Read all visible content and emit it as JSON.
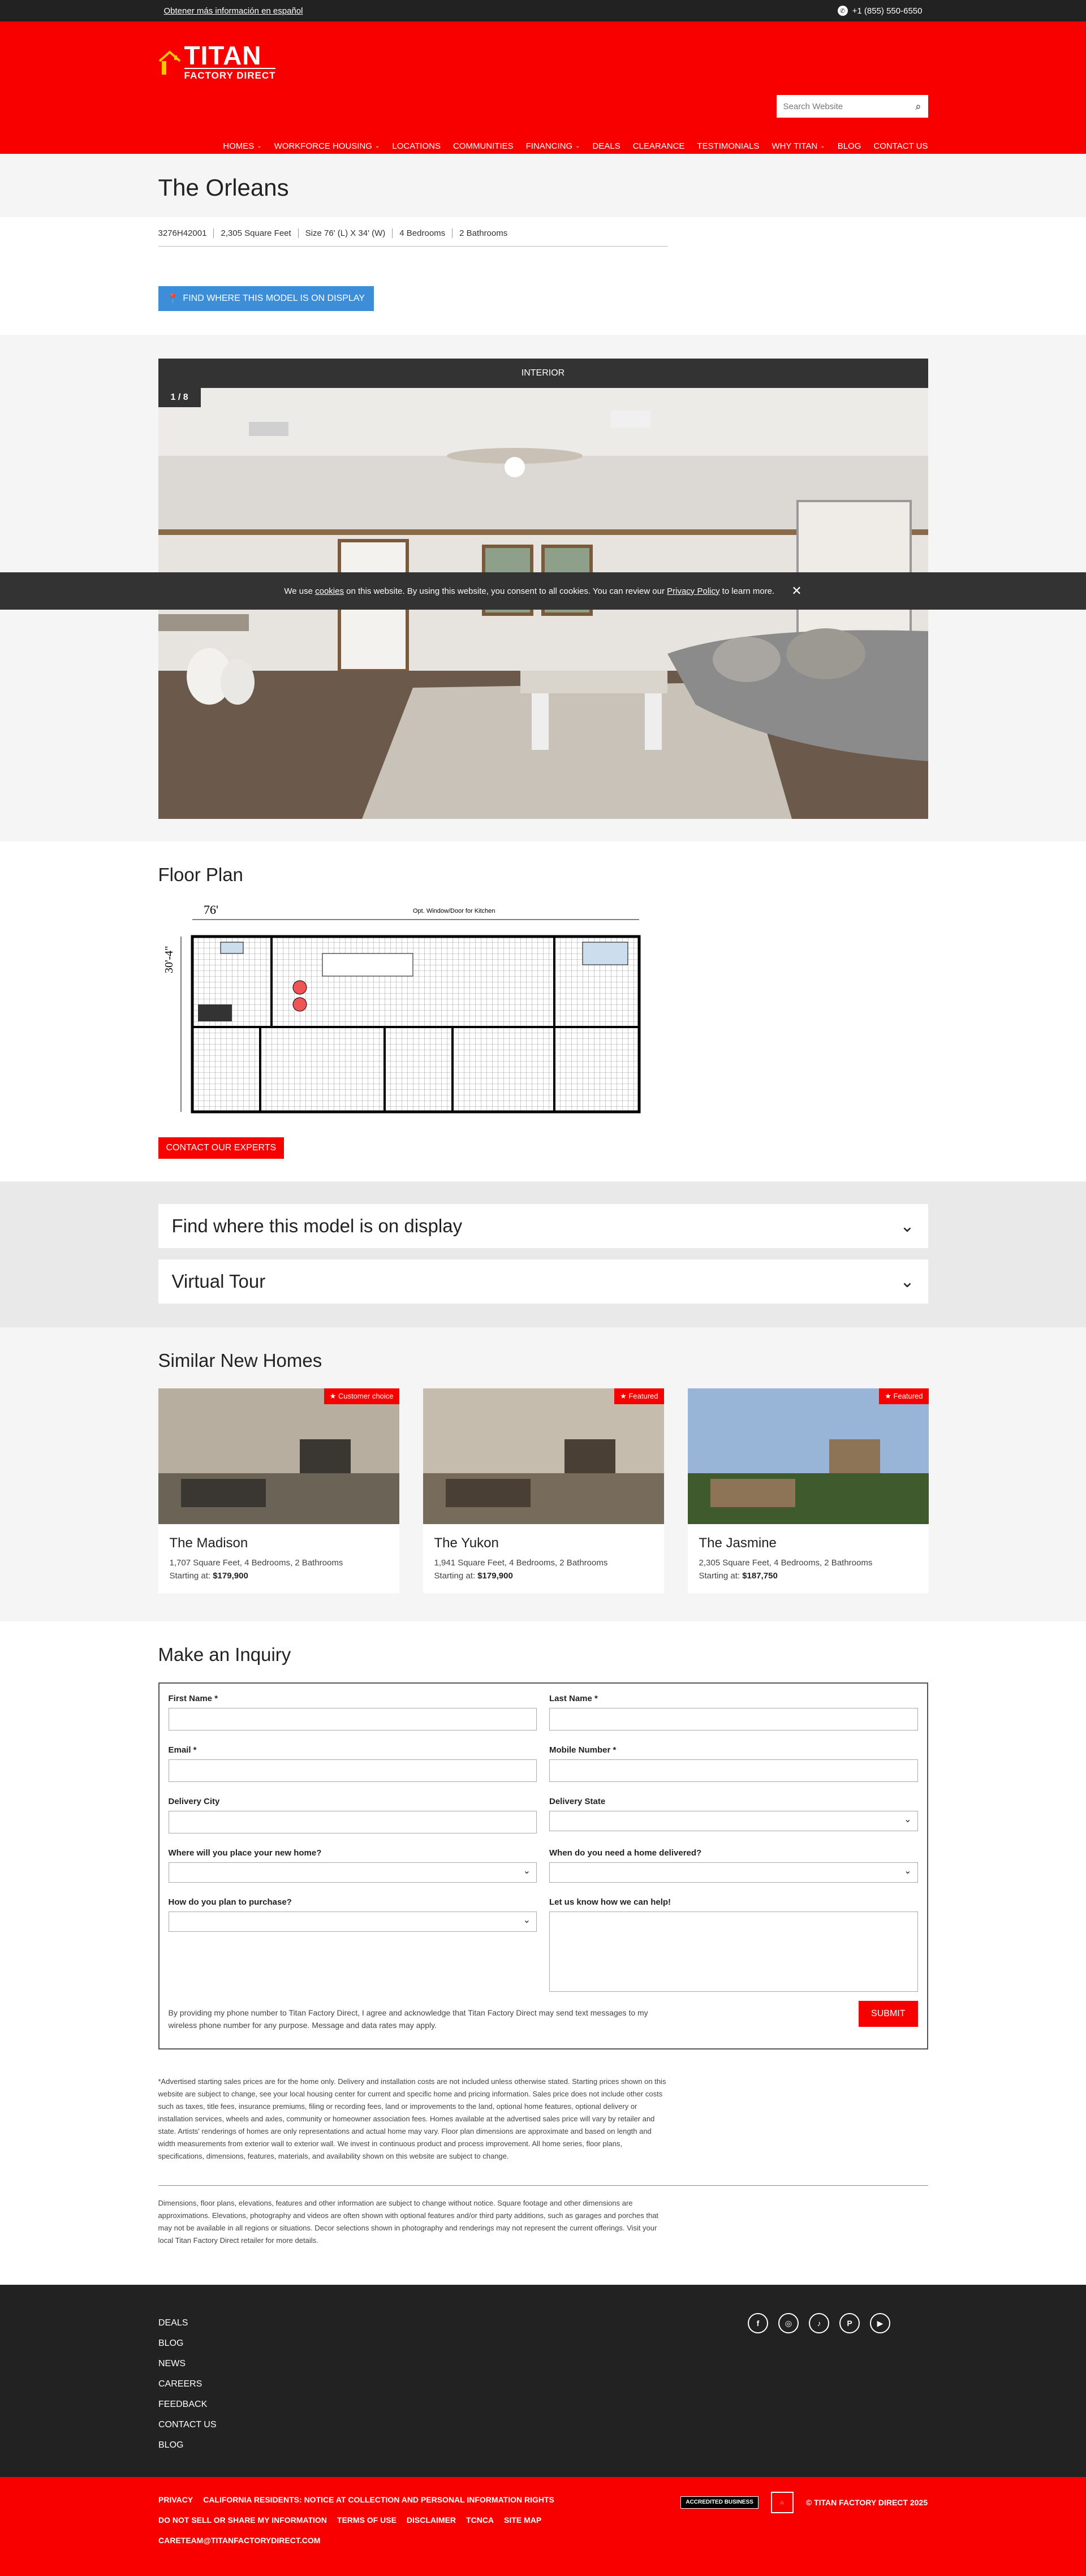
{
  "topbar": {
    "lang": "Obtener más información en español",
    "phone": "+1 (855) 550-6550"
  },
  "brand": {
    "name": "TITAN",
    "tagline": "FACTORY DIRECT"
  },
  "search": {
    "placeholder": "Search Website"
  },
  "nav": [
    {
      "label": "Homes",
      "dropdown": true
    },
    {
      "label": "Workforce Housing",
      "dropdown": true
    },
    {
      "label": "Locations",
      "dropdown": false
    },
    {
      "label": "Communities",
      "dropdown": false
    },
    {
      "label": "Financing",
      "dropdown": true
    },
    {
      "label": "Deals",
      "dropdown": false
    },
    {
      "label": "Clearance",
      "dropdown": false
    },
    {
      "label": "Testimonials",
      "dropdown": false
    },
    {
      "label": "Why Titan",
      "dropdown": true
    },
    {
      "label": "Blog",
      "dropdown": false
    },
    {
      "label": "Contact Us",
      "dropdown": false
    }
  ],
  "model": {
    "title": "The Orleans",
    "specs": [
      "3276H42001",
      "2,305 Square Feet",
      "Size 76' (L) X 34' (W)",
      "4 Bedrooms",
      "2 Bathrooms"
    ],
    "find_button": "Find where this model is on display"
  },
  "gallery": {
    "header": "Interior",
    "counter": "1 / 8"
  },
  "cookie": {
    "pre": "We use ",
    "link1": "cookies",
    "mid": " on this website. By using this website, you consent to all cookies. You can review our ",
    "link2": "Privacy Policy",
    "post": " to learn more."
  },
  "floorplan": {
    "title": "Floor Plan",
    "width_label": "76'",
    "depth_label": "30'-4\"",
    "note": "Opt. Window/Door for Kitchen",
    "button": "Contact Our Experts"
  },
  "accordions": [
    "Find where this model is on display",
    "Virtual Tour"
  ],
  "similar": {
    "title": "Similar New Homes",
    "cards": [
      {
        "badge": "Customer choice",
        "name": "The Madison",
        "details": "1,707 Square Feet, 4 Bedrooms, 2 Bathrooms",
        "price_label": "Starting at:",
        "price": "$179,900"
      },
      {
        "badge": "Featured",
        "name": "The Yukon",
        "details": "1,941 Square Feet, 4 Bedrooms, 2 Bathrooms",
        "price_label": "Starting at:",
        "price": "$179,900"
      },
      {
        "badge": "Featured",
        "name": "The Jasmine",
        "details": "2,305 Square Feet, 4 Bedrooms, 2 Bathrooms",
        "price_label": "Starting at:",
        "price": "$187,750"
      }
    ]
  },
  "inquiry": {
    "title": "Make an Inquiry",
    "first_name": "First Name *",
    "last_name": "Last Name *",
    "email": "Email *",
    "mobile": "Mobile Number *",
    "city": "Delivery City",
    "state": "Delivery State",
    "place": "Where will you place your new home?",
    "when": "When do you need a home delivered?",
    "purchase": "How do you plan to purchase?",
    "help": "Let us know how we can help!",
    "consent": "By providing my phone number to Titan Factory Direct, I agree and acknowledge that Titan Factory Direct may send text messages to my wireless phone number for any purpose. Message and data rates may apply.",
    "submit": "Submit"
  },
  "disclaimer": "*Advertised starting sales prices are for the home only. Delivery and installation costs are not included unless otherwise stated. Starting prices shown on this website are subject to change, see your local housing center for current and specific home and pricing information. Sales price does not include other costs such as taxes, title fees, insurance premiums, filing or recording fees, land or improvements to the land, optional home features, optional delivery or installation services, wheels and axles, community or homeowner association fees. Homes available at the advertised sales price will vary by retailer and state. Artists' renderings of homes are only representations and actual home may vary. Floor plan dimensions are approximate and based on length and width measurements from exterior wall to exterior wall. We invest in continuous product and process improvement. All home series, floor plans, specifications, dimensions, features, materials, and availability shown on this website are subject to change.",
  "disclaimer2": "Dimensions, floor plans, elevations, features and other information are subject to change without notice. Square footage and other dimensions are approximations. Elevations, photography and videos are often shown with optional features and/or third party additions, such as garages and porches that may not be available in all regions or situations. Decor selections shown in photography and renderings may not represent the current offerings. Visit your local Titan Factory Direct retailer for more details.",
  "footer": {
    "links": [
      "Deals",
      "Blog",
      "News",
      "Careers",
      "Feedback",
      "Contact Us",
      "Blog"
    ],
    "social": [
      "f",
      "◎",
      "♪",
      "P",
      "▶"
    ]
  },
  "bottom": {
    "row1": [
      "Privacy",
      "California Residents: Notice at Collection and Personal Information Rights"
    ],
    "row2": [
      "Do Not Sell or Share My Information",
      "Terms of Use",
      "Disclaimer",
      "TCNCA",
      "Site Map"
    ],
    "email": "CareTeam@TitanFactoryDirect.com",
    "bbb": "ACCREDITED BUSINESS",
    "copyright": "© Titan Factory Direct 2025"
  }
}
